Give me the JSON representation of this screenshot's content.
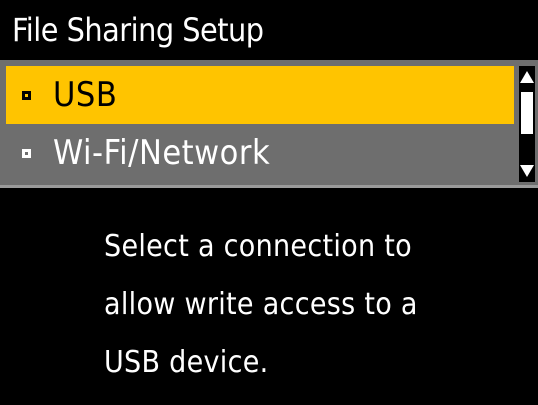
{
  "screen": {
    "title": "File Sharing Setup"
  },
  "menu": {
    "items": [
      {
        "label": "USB",
        "selected": true
      },
      {
        "label": "Wi-Fi/Network",
        "selected": false
      }
    ]
  },
  "icons": {
    "bullet": "square-bullet-icon",
    "scroll_up": "scroll-up-arrow-icon",
    "scroll_down": "scroll-down-arrow-icon"
  },
  "message": {
    "lines": [
      "Select a connection to",
      "allow write access to a",
      "USB device."
    ]
  },
  "colors": {
    "highlight": "#ffc400",
    "menu_background": "#6e6e6e",
    "screen_background": "#000000",
    "text": "#ffffff"
  }
}
